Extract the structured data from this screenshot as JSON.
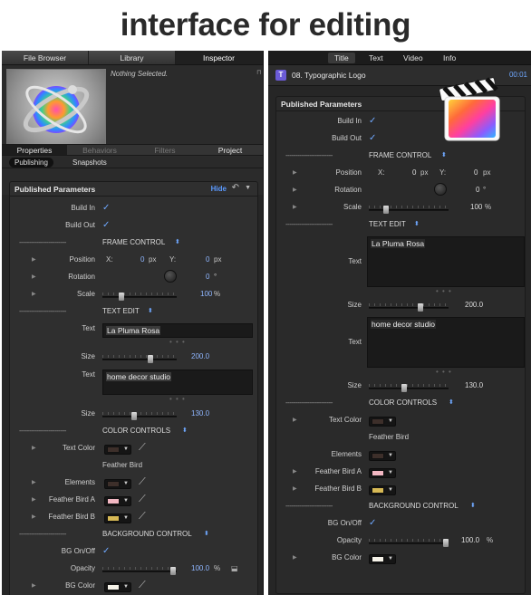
{
  "headline": "interface for editing",
  "colors": {
    "panel_bg": "#262626",
    "accent_blue": "#5b9aff",
    "feather_bird_a": "#f2b7c2",
    "feather_bird_b": "#d7b955",
    "text_color": "#3d2f2a",
    "elements": "#3d2f2a",
    "bg_color": "#f6f3e9"
  },
  "left": {
    "tabs": [
      "File Browser",
      "Library",
      "Inspector"
    ],
    "active_tab": "Inspector",
    "nothing_selected": "Nothing Selected.",
    "subtabs": [
      "Properties",
      "Behaviors",
      "Filters",
      "Project"
    ],
    "pills": [
      "Publishing",
      "Snapshots"
    ],
    "published_title": "Published Parameters",
    "hide_label": "Hide",
    "build_in": "Build In",
    "build_out": "Build Out",
    "dashes": "------------------------",
    "frame_control": "FRAME CONTROL",
    "position": "Position",
    "x_label": "X:",
    "y_label": "Y:",
    "pos_x": "0",
    "pos_y": "0",
    "px": "px",
    "rotation": "Rotation",
    "rot_val": "0",
    "deg": "°",
    "scale": "Scale",
    "scale_val": "100",
    "percent": "%",
    "text_edit": "TEXT EDIT",
    "text_label": "Text",
    "text1": "La Pluma Rosa",
    "size_label": "Size",
    "size1": "200.0",
    "text2": "home decor studio",
    "size2": "130.0",
    "color_controls": "COLOR CONTROLS",
    "text_color": "Text Color",
    "feather_bird": "Feather Bird",
    "elements": "Elements",
    "feather_bird_a": "Feather Bird A",
    "feather_bird_b": "Feather Bird B",
    "background_control": "BACKGROUND CONTROL",
    "bg_onoff": "BG On/Off",
    "opacity": "Opacity",
    "opacity_val": "100.0",
    "bg_color": "BG Color",
    "dots": "• • •"
  },
  "right": {
    "tabs": [
      "Title",
      "Text",
      "Video",
      "Info"
    ],
    "active_tab": "Title",
    "title_name": "08. Typographic Logo",
    "timecode": "00:01",
    "icon_letter": "T",
    "published_title": "Published Parameters"
  },
  "icons": [
    "motion-app-icon",
    "final-cut-pro-icon",
    "eyedropper-icon",
    "lock-icon",
    "undo-icon",
    "disclosure-triangle-icon"
  ]
}
